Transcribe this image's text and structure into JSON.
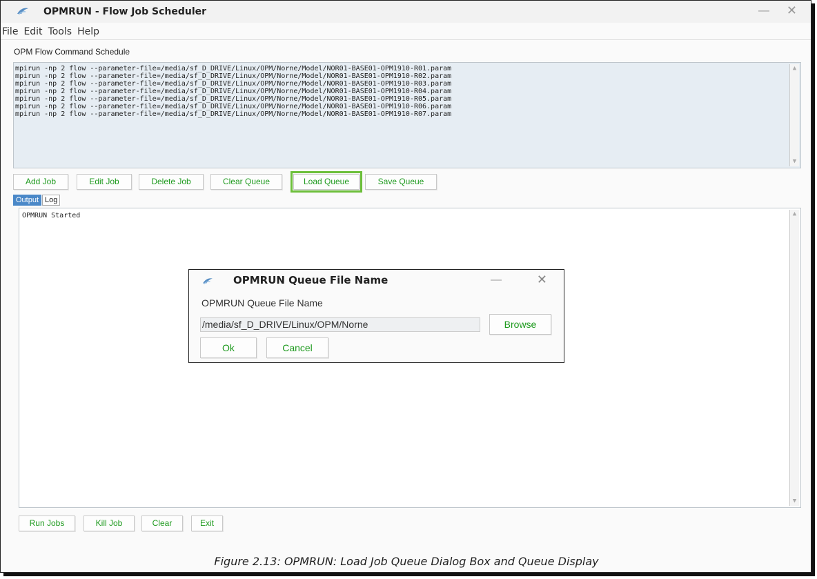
{
  "window": {
    "title": "OPMRUN - Flow Job Scheduler",
    "minimize": "—",
    "close": "✕"
  },
  "menu": [
    "File",
    "Edit",
    "Tools",
    "Help"
  ],
  "schedule": {
    "label": "OPM Flow Command Schedule",
    "lines": [
      "mpirun -np 2 flow --parameter-file=/media/sf_D_DRIVE/Linux/OPM/Norne/Model/NOR01-BASE01-OPM1910-R01.param",
      "mpirun -np 2 flow --parameter-file=/media/sf_D_DRIVE/Linux/OPM/Norne/Model/NOR01-BASE01-OPM1910-R02.param",
      "mpirun -np 2 flow --parameter-file=/media/sf_D_DRIVE/Linux/OPM/Norne/Model/NOR01-BASE01-OPM1910-R03.param",
      "mpirun -np 2 flow --parameter-file=/media/sf_D_DRIVE/Linux/OPM/Norne/Model/NOR01-BASE01-OPM1910-R04.param",
      "mpirun -np 2 flow --parameter-file=/media/sf_D_DRIVE/Linux/OPM/Norne/Model/NOR01-BASE01-OPM1910-R05.param",
      "mpirun -np 2 flow --parameter-file=/media/sf_D_DRIVE/Linux/OPM/Norne/Model/NOR01-BASE01-OPM1910-R06.param",
      "mpirun -np 2 flow --parameter-file=/media/sf_D_DRIVE/Linux/OPM/Norne/Model/NOR01-BASE01-OPM1910-R07.param"
    ]
  },
  "queue_buttons": {
    "add_job": "Add Job",
    "edit_job": "Edit Job",
    "delete_job": "Delete Job",
    "clear_queue": "Clear Queue",
    "load_queue": "Load Queue",
    "save_queue": "Save Queue"
  },
  "tabs": {
    "output": "Output",
    "log": "Log"
  },
  "output_text": "OPMRUN Started",
  "run_buttons": {
    "run_jobs": "Run Jobs",
    "kill_job": "Kill Job",
    "clear": "Clear",
    "exit": "Exit"
  },
  "dialog": {
    "title": "OPMRUN Queue File Name",
    "label": "OPMRUN Queue File Name",
    "input_value": "/media/sf_D_DRIVE/Linux/OPM/Norne",
    "browse": "Browse",
    "ok": "Ok",
    "cancel": "Cancel",
    "minimize": "—",
    "close": "✕"
  },
  "caption": "Figure 2.13: OPMRUN: Load Job Queue Dialog Box and Queue Display",
  "colors": {
    "button_text": "#1e9a1e",
    "highlight_outline": "#6cbf3a",
    "schedule_bg": "#e6edf3",
    "active_tab": "#4a88c8"
  }
}
